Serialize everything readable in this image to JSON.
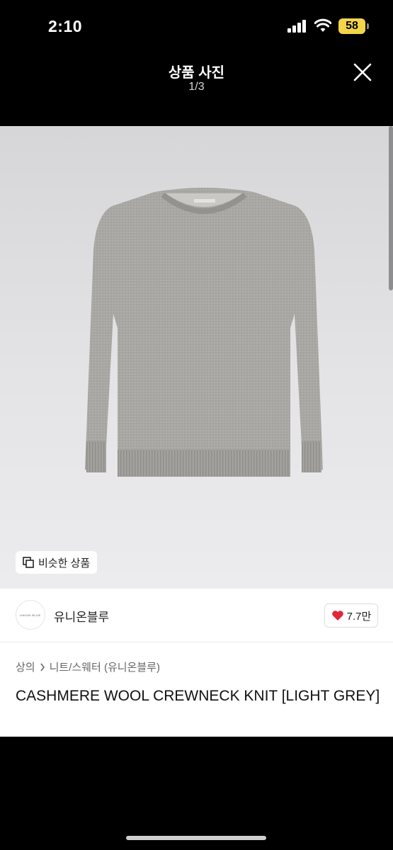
{
  "status_bar": {
    "time": "2:10",
    "battery": "58"
  },
  "header": {
    "title": "상품 사진",
    "counter": "1/3"
  },
  "photo": {
    "logo_text": "UNION BLUE",
    "similar_label": "비슷한 상품"
  },
  "brand": {
    "logo_text": "UNION BLUE",
    "name": "유니온블루",
    "likes": "7.7만"
  },
  "breadcrumb": {
    "category": "상의",
    "subcategory": "니트/스웨터 (유니온블루)"
  },
  "product": {
    "title": "CASHMERE WOOL CREWNECK KNIT [LIGHT GREY]"
  },
  "colors": {
    "accent_heart": "#e0283a",
    "battery": "#f3d54a"
  },
  "icons": [
    "cellular-signal-icon",
    "wifi-icon",
    "battery-icon",
    "close-icon",
    "similar-items-icon",
    "heart-icon",
    "chevron-right-icon"
  ]
}
